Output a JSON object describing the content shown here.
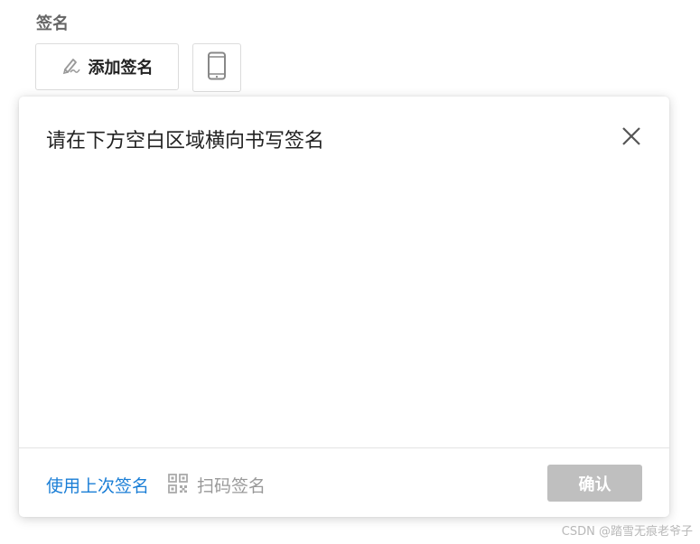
{
  "field": {
    "label": "签名"
  },
  "buttons": {
    "add_signature_label": "添加签名"
  },
  "dialog": {
    "title": "请在下方空白区域横向书写签名",
    "footer": {
      "use_last_label": "使用上次签名",
      "scan_label": "扫码签名",
      "confirm_label": "确认"
    }
  },
  "watermark": {
    "text": "CSDN @踏雪无痕老爷子"
  },
  "colors": {
    "link": "#1a7ed6",
    "confirm_disabled": "#bfbfbf",
    "muted_text": "#999999",
    "border": "#dcdcdc"
  },
  "icons": {
    "add_signature": "pen-icon",
    "mobile": "mobile-phone-icon",
    "close": "close-icon",
    "scan": "qr-code-icon"
  }
}
